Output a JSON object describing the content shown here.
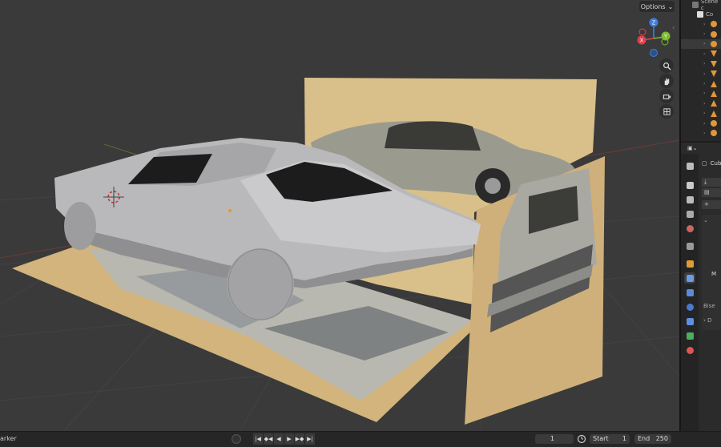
{
  "viewport": {
    "options_label": "Options",
    "gizmo": {
      "z": "Z",
      "y": "Y",
      "x": "X"
    }
  },
  "timeline": {
    "marker_label": "arker",
    "current_frame": "1",
    "start_label": "Start",
    "start_value": "1",
    "end_label": "End",
    "end_value": "250",
    "transport_icons": [
      "jump-start",
      "prev-keyframe",
      "play-reverse",
      "play",
      "next-keyframe",
      "jump-end"
    ]
  },
  "outliner": {
    "title": "Scene c",
    "collection_label": "Co",
    "rows": [
      "camera",
      "camera",
      "camera",
      "cone",
      "cone",
      "cone",
      "mesh",
      "mesh",
      "mesh",
      "mesh",
      "light",
      "light"
    ]
  },
  "properties": {
    "object_name": "Cub",
    "modifier_abbrev": "M",
    "bisect_abbrev": "Bise",
    "collapsed_abbrev": "D",
    "add_symbol": "+"
  },
  "colors": {
    "viewport_bg": "#3a3a3a",
    "x_axis": "#e0404a",
    "y_axis": "#7bbd2a",
    "z_axis": "#3d7fe0",
    "panel_bg": "#2b2b2b"
  }
}
